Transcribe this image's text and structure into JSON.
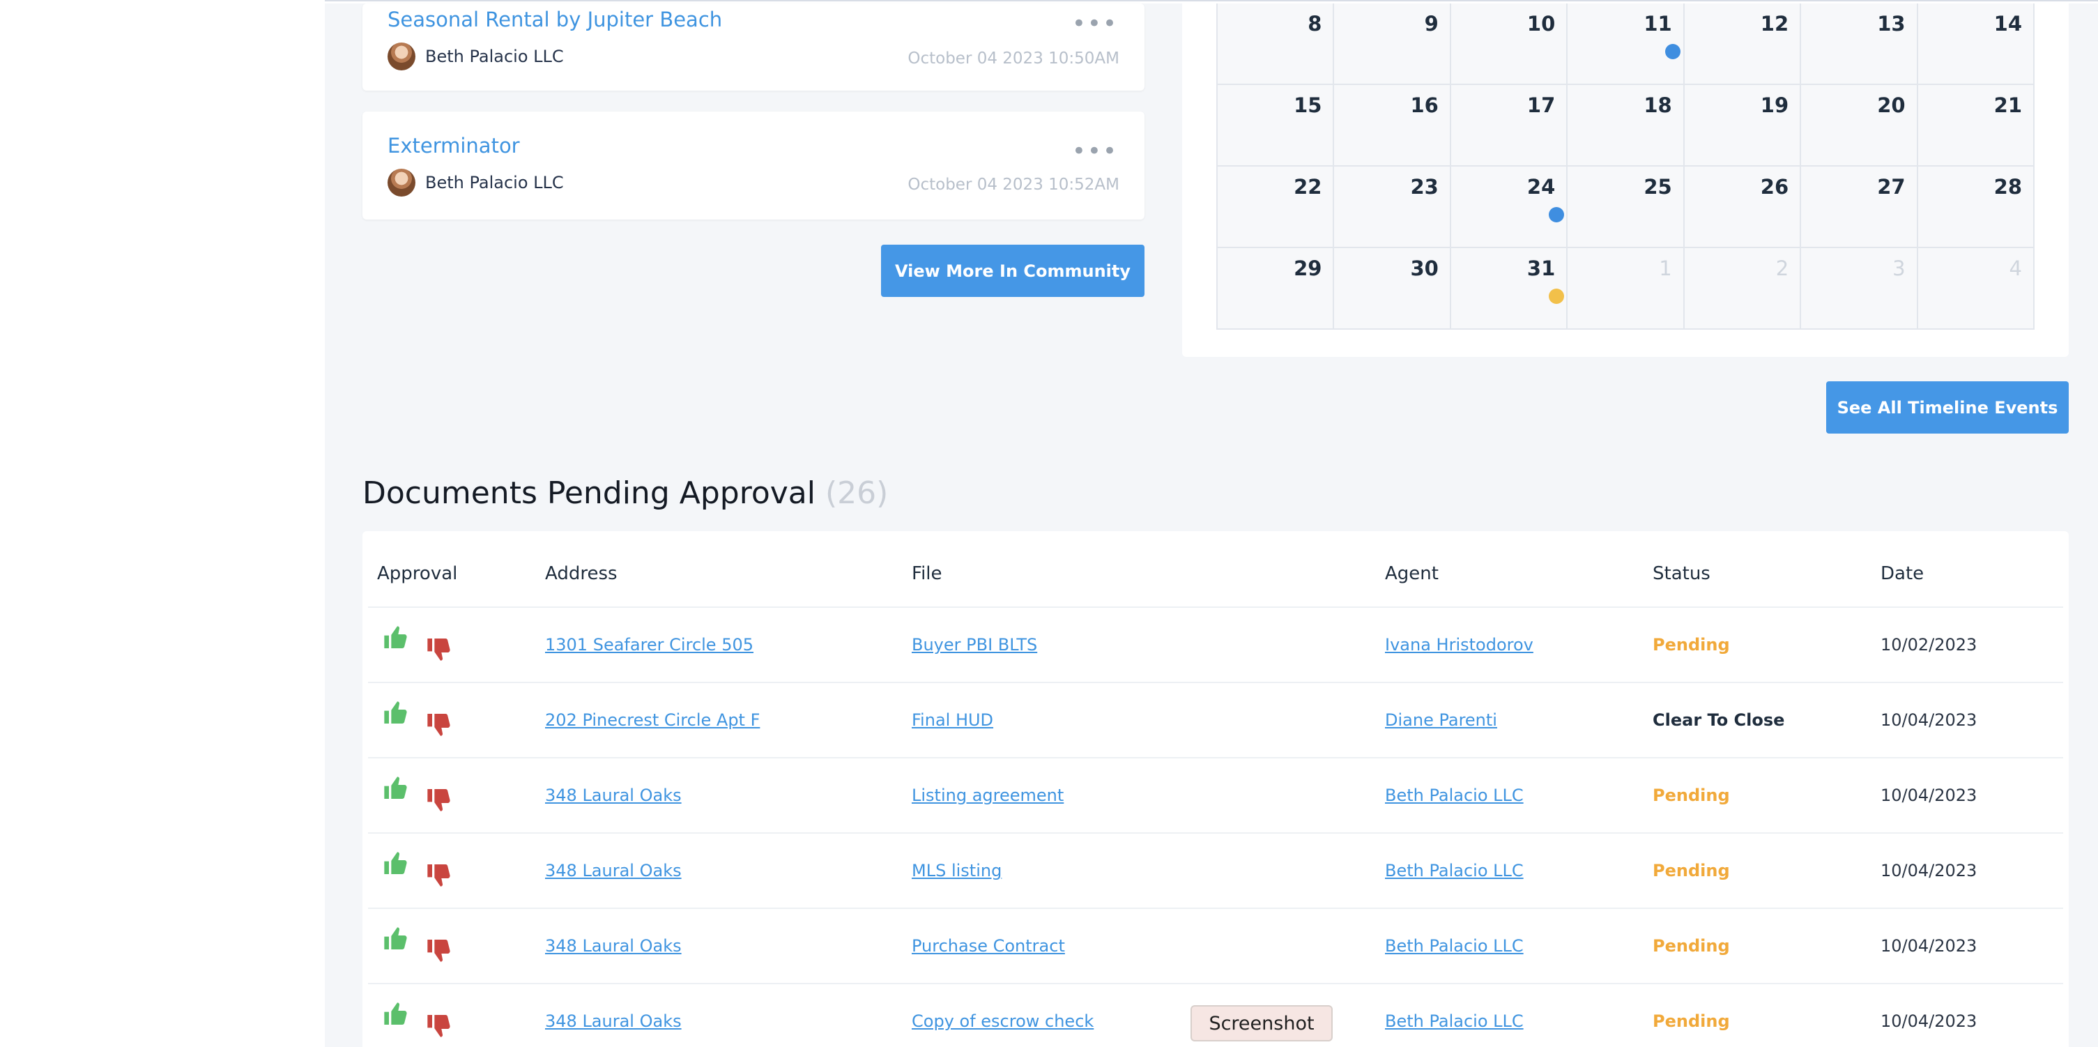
{
  "community": {
    "posts": [
      {
        "title": "Seasonal Rental by Jupiter Beach",
        "author": "Beth Palacio LLC",
        "date": "October 04 2023 10:50AM"
      },
      {
        "title": "Exterminator",
        "author": "Beth Palacio LLC",
        "date": "October 04 2023 10:52AM"
      }
    ],
    "view_more_label": "View More In Community"
  },
  "calendar": {
    "rows": [
      [
        "8",
        "9",
        "10",
        "11",
        "12",
        "13",
        "14"
      ],
      [
        "15",
        "16",
        "17",
        "18",
        "19",
        "20",
        "21"
      ],
      [
        "22",
        "23",
        "24",
        "25",
        "26",
        "27",
        "28"
      ],
      [
        "29",
        "30",
        "31",
        "1",
        "2",
        "3",
        "4"
      ]
    ],
    "event_colors": {
      "blue": "#3f8ee0",
      "yellow": "#f2c04a"
    }
  },
  "timeline": {
    "see_all_label": "See All Timeline Events"
  },
  "documents": {
    "title": "Documents Pending Approval",
    "count": "(26)",
    "headers": {
      "approval": "Approval",
      "address": "Address",
      "file": "File",
      "agent": "Agent",
      "status": "Status",
      "date": "Date"
    },
    "rows": [
      {
        "address": "1301 Seafarer Circle 505",
        "file": "Buyer PBI BLTS",
        "agent": "Ivana Hristodorov",
        "status": "Pending",
        "date": "10/02/2023"
      },
      {
        "address": "202 Pinecrest Circle Apt F",
        "file": "Final HUD",
        "agent": "Diane Parenti",
        "status": "Clear To Close",
        "date": "10/04/2023"
      },
      {
        "address": "348 Laural Oaks",
        "file": "Listing agreement",
        "agent": "Beth Palacio LLC",
        "status": "Pending",
        "date": "10/04/2023"
      },
      {
        "address": "348 Laural Oaks",
        "file": "MLS listing",
        "agent": "Beth Palacio LLC",
        "status": "Pending",
        "date": "10/04/2023"
      },
      {
        "address": "348 Laural Oaks",
        "file": "Purchase Contract",
        "agent": "Beth Palacio LLC",
        "status": "Pending",
        "date": "10/04/2023"
      },
      {
        "address": "348 Laural Oaks",
        "file": "Copy of escrow check",
        "agent": "Beth Palacio LLC",
        "status": "Pending",
        "date": "10/04/2023"
      }
    ],
    "icons": {
      "approve": "thumbs-up-icon",
      "reject": "thumbs-down-icon"
    },
    "colors": {
      "approve": "#5bbf6b",
      "reject": "#c9453f",
      "pending": "#f1a93a"
    }
  },
  "tooltip": {
    "label": "Screenshot"
  }
}
